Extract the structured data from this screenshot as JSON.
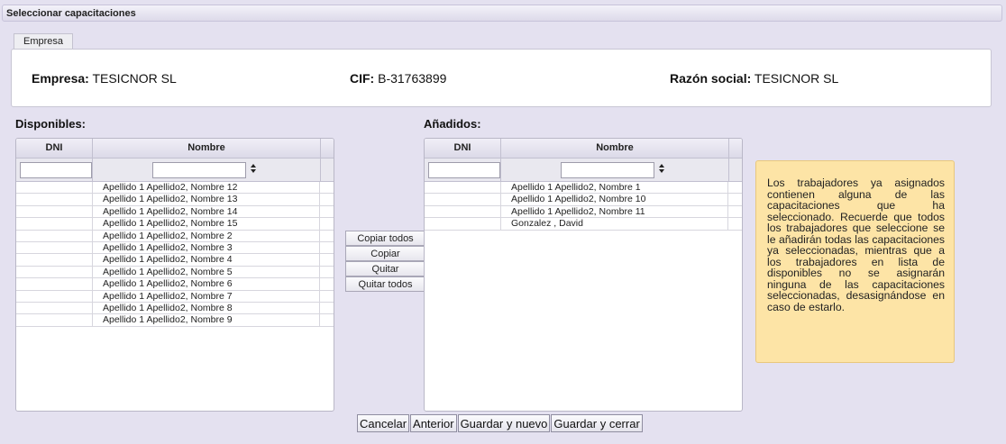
{
  "window": {
    "title": "Seleccionar capacitaciones"
  },
  "tabs": [
    {
      "label": "Empresa"
    }
  ],
  "company": {
    "empresa_label": "Empresa:",
    "empresa_value": "TESICNOR SL",
    "cif_label": "CIF:",
    "cif_value": "B-31763899",
    "razon_label": "Razón social:",
    "razon_value": "TESICNOR SL"
  },
  "available": {
    "title": "Disponibles:",
    "columns": [
      "DNI",
      "Nombre"
    ],
    "filter_dni": "",
    "filter_nombre": "",
    "rows": [
      {
        "dni": "",
        "nombre": "Apellido 1 Apellido2, Nombre 12"
      },
      {
        "dni": "",
        "nombre": "Apellido 1 Apellido2, Nombre 13"
      },
      {
        "dni": "",
        "nombre": "Apellido 1 Apellido2, Nombre 14"
      },
      {
        "dni": "",
        "nombre": "Apellido 1 Apellido2, Nombre 15"
      },
      {
        "dni": "",
        "nombre": "Apellido 1 Apellido2, Nombre 2"
      },
      {
        "dni": "",
        "nombre": "Apellido 1 Apellido2, Nombre 3"
      },
      {
        "dni": "",
        "nombre": "Apellido 1 Apellido2, Nombre 4"
      },
      {
        "dni": "",
        "nombre": "Apellido 1 Apellido2, Nombre 5"
      },
      {
        "dni": "",
        "nombre": "Apellido 1 Apellido2, Nombre 6"
      },
      {
        "dni": "",
        "nombre": "Apellido 1 Apellido2, Nombre 7"
      },
      {
        "dni": "",
        "nombre": "Apellido 1 Apellido2, Nombre 8"
      },
      {
        "dni": "",
        "nombre": "Apellido 1 Apellido2, Nombre 9"
      }
    ]
  },
  "added": {
    "title": "Añadidos:",
    "columns": [
      "DNI",
      "Nombre"
    ],
    "filter_dni": "",
    "filter_nombre": "",
    "rows": [
      {
        "dni": "",
        "nombre": "Apellido 1 Apellido2, Nombre 1"
      },
      {
        "dni": "",
        "nombre": "Apellido 1 Apellido2, Nombre 10"
      },
      {
        "dni": "",
        "nombre": "Apellido 1 Apellido2, Nombre 11"
      },
      {
        "dni": "",
        "nombre": "Gonzalez , David"
      }
    ]
  },
  "transfer": {
    "copy_all": "Copiar todos",
    "copy": "Copiar",
    "remove": "Quitar",
    "remove_all": "Quitar todos"
  },
  "sort_icon": "sort-arrows-icon",
  "note": "Los trabajadores ya asignados contienen alguna de las capacitaciones que ha seleccionado. Recuerde que todos los trabajadores que seleccione se le añadirán todas las capacitaciones ya seleccionadas, mientras que a los trabajadores en lista de disponibles no se asignarán ninguna de las capacitaciones seleccionadas, desasignándose en caso de estarlo.",
  "footer": {
    "cancel": "Cancelar",
    "previous": "Anterior",
    "save_new": "Guardar y nuevo",
    "save_close": "Guardar y cerrar"
  },
  "colors": {
    "background": "#e4e1f0",
    "note_bg": "#fde4a6",
    "note_border": "#e8c77d"
  }
}
